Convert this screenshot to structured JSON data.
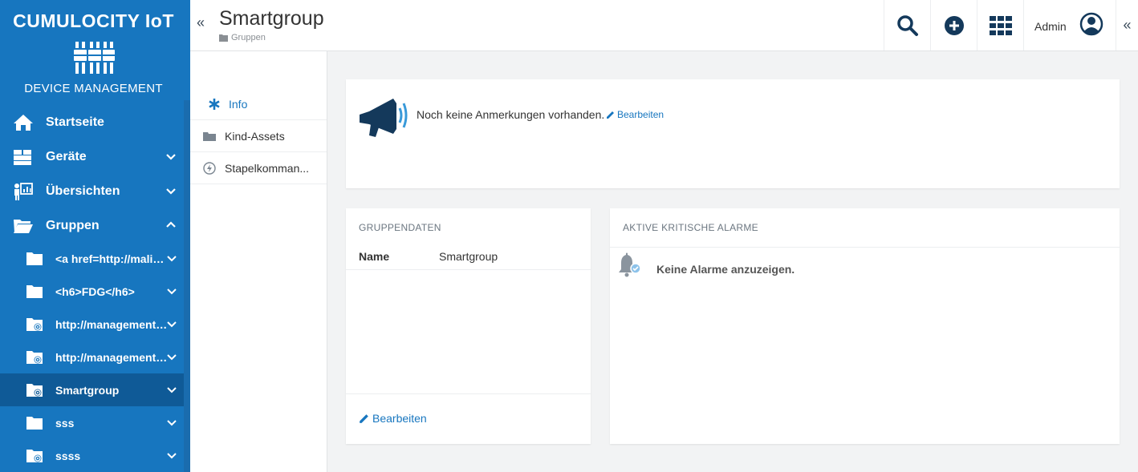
{
  "brand": {
    "title": "CUMULOCITY IoT",
    "subtitle": "DEVICE MANAGEMENT"
  },
  "nav": {
    "home": "Startseite",
    "devices": "Geräte",
    "overviews": "Übersichten",
    "groups": "Gruppen",
    "group_items": [
      {
        "label": "<a href=http://malici...",
        "icon": "folder-icon"
      },
      {
        "label": "<h6>FDG</h6>",
        "icon": "folder-icon"
      },
      {
        "label": "http://management.s...",
        "icon": "folder-gear-icon"
      },
      {
        "label": "http://management.s...",
        "icon": "folder-gear-icon"
      },
      {
        "label": "Smartgroup",
        "icon": "folder-gear-icon",
        "active": true
      },
      {
        "label": "sss",
        "icon": "folder-icon"
      },
      {
        "label": "ssss",
        "icon": "folder-gear-icon"
      }
    ]
  },
  "header": {
    "title": "Smartgroup",
    "breadcrumb": "Gruppen",
    "collapse": "«",
    "collapse_right": "«",
    "user": "Admin"
  },
  "tabs": [
    "Info",
    "Kind-Assets",
    "Stapelkomman..."
  ],
  "notes": {
    "text": "Noch keine Anmerkungen vorhanden.",
    "edit": "Bearbeiten"
  },
  "group_data": {
    "title": "GRUPPENDATEN",
    "name_label": "Name",
    "name_value": "Smartgroup",
    "edit": "Bearbeiten"
  },
  "alarms": {
    "title": "AKTIVE KRITISCHE ALARME",
    "empty": "Keine Alarme anzuzeigen."
  },
  "colors": {
    "sidebar": "#1776bf",
    "sidebar_active": "#0f5a97",
    "accent": "#1776bf",
    "icon_dark": "#14395b"
  }
}
